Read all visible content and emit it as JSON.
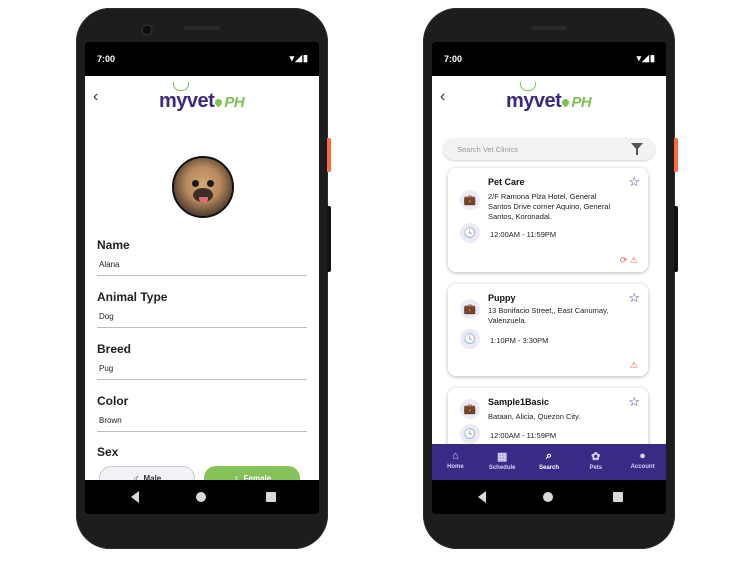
{
  "status_bar": {
    "time": "7:00",
    "icons": "▾◢▮"
  },
  "app": {
    "logo_main": "myvet",
    "logo_suffix": "PH",
    "back_glyph": "‹"
  },
  "pet_form": {
    "fields": [
      {
        "label": "Name",
        "value": "Alana"
      },
      {
        "label": "Animal Type",
        "value": "Dog"
      },
      {
        "label": "Breed",
        "value": "Pug"
      },
      {
        "label": "Color",
        "value": "Brown"
      }
    ],
    "sex_label": "Sex",
    "male_label": "Male",
    "female_label": "Female",
    "male_icon": "♂",
    "female_icon": "♀",
    "selected_sex": "Female"
  },
  "clinics": {
    "search_placeholder": "Search Vet Clinics",
    "list": [
      {
        "name": "Pet Care",
        "address": "2/F Ramona Plza Hotel, General Santos Drive corner Aquino, General Santos, Koronadal.",
        "hours": "12:00AM - 11:59PM"
      },
      {
        "name": "Puppy",
        "address": "13 Bonifacio Street,, East Canumay, Valenzuela.",
        "hours": "1:10PM - 3:30PM"
      },
      {
        "name": "Sample1Basic",
        "address": "Bataan, Alicia, Quezon City.",
        "hours": "12:00AM - 11:59PM"
      }
    ]
  },
  "icons": {
    "star": "☆",
    "briefcase": "💼",
    "clock": "🕓",
    "badge_a": "⟳",
    "badge_b": "⚠"
  },
  "tabs": [
    {
      "label": "Home",
      "icon": "⌂"
    },
    {
      "label": "Schedule",
      "icon": "▦"
    },
    {
      "label": "Search",
      "icon": "⌕"
    },
    {
      "label": "Pets",
      "icon": "✿"
    },
    {
      "label": "Account",
      "icon": "●"
    }
  ],
  "colors": {
    "brand": "#3a2a86",
    "accent": "#7ec252",
    "alert": "#e0604a"
  }
}
